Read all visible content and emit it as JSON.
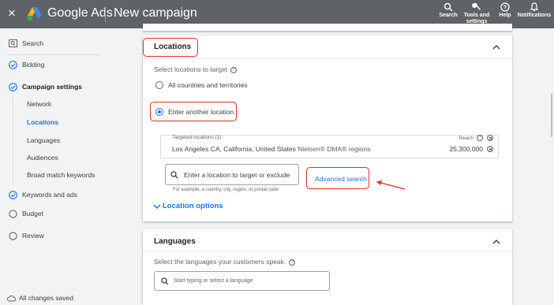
{
  "topbar": {
    "close_glyph": "×",
    "brand": "Google Ads",
    "page_title": "New campaign",
    "actions": [
      {
        "label": "Search",
        "icon": "search-icon"
      },
      {
        "label": "Tools and settings",
        "icon": "wrench-icon"
      },
      {
        "label": "Help",
        "icon": "help-icon"
      },
      {
        "label": "Notifications",
        "icon": "bell-icon"
      }
    ]
  },
  "sidebar": {
    "items": {
      "search": "Search",
      "bidding": "Bidding",
      "campaign_settings": "Campaign settings",
      "network": "Network",
      "locations": "Locations",
      "languages": "Languages",
      "audiences": "Audiences",
      "broad_match": "Broad match keywords",
      "keywords_ads": "Keywords and ads",
      "budget": "Budget",
      "review": "Review"
    },
    "saved": "All changes saved"
  },
  "locations": {
    "title": "Locations",
    "prompt": "Select locations to target",
    "opt_all": "All countries and territories",
    "opt_other": "Enter another location",
    "targeted_header": "Targeted locations (1)",
    "reach_header": "Reach",
    "loc_name": "Los Angeles CA, California, United States",
    "loc_type": "Nielsen® DMA® regions",
    "reach_value": "25,300,000",
    "input_placeholder": "Enter a location to target or exclude",
    "input_hint": "For example, a country, city, region, or postal code",
    "advanced": "Advanced search",
    "options": "Location options"
  },
  "languages": {
    "title": "Languages",
    "prompt": "Select the languages your customers speak.",
    "input_placeholder": "Start typing or select a language"
  },
  "colors": {
    "topbar": "#5f6368",
    "accent": "#1a73e8",
    "highlight": "#d93025"
  }
}
